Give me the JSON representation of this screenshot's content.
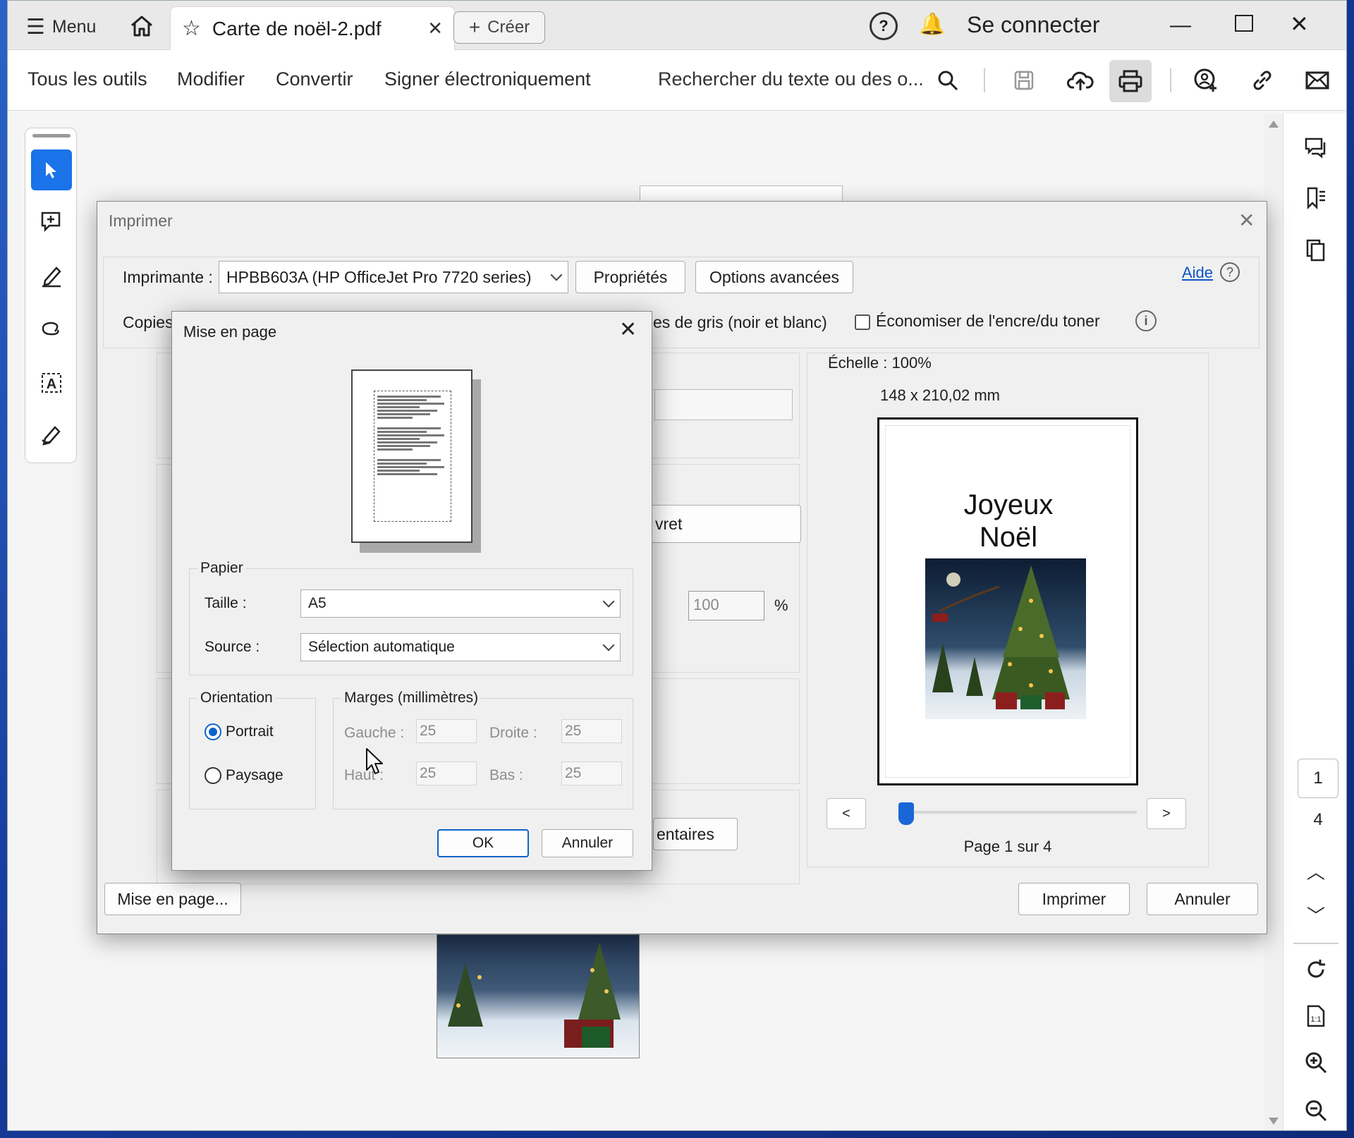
{
  "titlebar": {
    "menu_label": "Menu",
    "tab_title": "Carte de noël-2.pdf",
    "create_label": "Créer",
    "signin_label": "Se connecter"
  },
  "toolbar": {
    "all_tools": "Tous les outils",
    "edit": "Modifier",
    "convert": "Convertir",
    "sign": "Signer électroniquement",
    "search_placeholder": "Rechercher du texte ou des o..."
  },
  "print_dialog": {
    "title": "Imprimer",
    "printer_label": "Imprimante :",
    "printer_value": "HPBB603A (HP OfficeJet Pro 7720 series)",
    "properties": "Propriétés",
    "advanced": "Options avancées",
    "help": "Aide",
    "copies_label": "Copies",
    "grayscale_partial": "es de gris (noir et blanc)",
    "save_ink": "Économiser de l'encre/du toner",
    "booklet_partial": "vret",
    "scale_value": "100",
    "scale_unit": "%",
    "comments_partial": "entaires",
    "scale_text": "Échelle : 100%",
    "size_text": "148 x 210,02 mm",
    "preview_title_1": "Joyeux",
    "preview_title_2": "Noël",
    "prev": "<",
    "next": ">",
    "page_indicator": "Page 1 sur 4",
    "page_setup_btn": "Mise en page...",
    "print_btn": "Imprimer",
    "cancel_btn": "Annuler",
    "page_slider_fraction": 0.0
  },
  "page_setup": {
    "title": "Mise en page",
    "paper_group": "Papier",
    "size_label": "Taille :",
    "size_value": "A5",
    "source_label": "Source :",
    "source_value": "Sélection automatique",
    "orientation_group": "Orientation",
    "portrait": "Portrait",
    "landscape": "Paysage",
    "margins_group": "Marges (millimètres)",
    "left_label": "Gauche :",
    "left_value": "25",
    "right_label": "Droite :",
    "right_value": "25",
    "top_label": "Haut :",
    "top_value": "25",
    "bottom_label": "Bas :",
    "bottom_value": "25",
    "ok": "OK",
    "cancel": "Annuler"
  },
  "right_rail": {
    "current_page": "1",
    "total_pages": "4"
  },
  "colors": {
    "accent": "#0b63c9",
    "selected_tool": "#1a73e8"
  }
}
